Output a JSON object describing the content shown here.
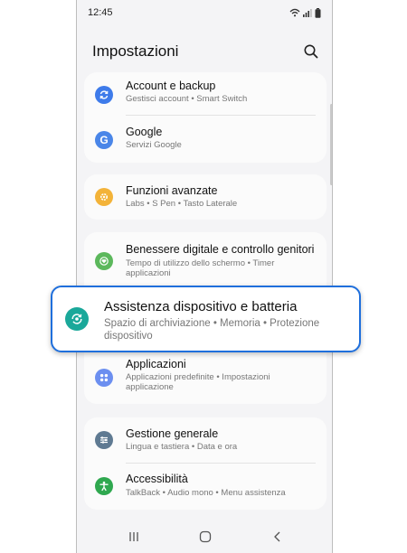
{
  "status_bar": {
    "time": "12:45"
  },
  "header": {
    "title": "Impostazioni"
  },
  "colors": {
    "accent_blue": "#1f6fdc",
    "account_icon": "#3e7bea",
    "google_icon": "#4a86e8",
    "advanced_icon": "#f3b339",
    "wellbeing_icon": "#5cb85c",
    "care_icon": "#1aa89a",
    "apps_icon": "#6c8ff0",
    "general_icon": "#5f7a92",
    "accessibility_icon": "#2fa84f"
  },
  "items": {
    "account": {
      "title": "Account e backup",
      "sub": "Gestisci account  •  Smart Switch",
      "icon": "sync-icon"
    },
    "google": {
      "title": "Google",
      "sub": "Servizi Google",
      "icon": "google-icon"
    },
    "advanced": {
      "title": "Funzioni avanzate",
      "sub": "Labs  •  S Pen  •  Tasto Laterale",
      "icon": "plus-gear-icon"
    },
    "wellbeing": {
      "title": "Benessere digitale e controllo genitori",
      "sub": "Tempo di utilizzo dello schermo  •  Timer applicazioni",
      "icon": "heart-circle-icon"
    },
    "care": {
      "title": "Assistenza dispositivo e batteria",
      "sub": "Spazio di archiviazione  •  Memoria  •  Protezione dispositivo",
      "icon": "device-care-icon"
    },
    "apps": {
      "title": "Applicazioni",
      "sub": "Applicazioni predefinite  •  Impostazioni applicazione",
      "icon": "apps-grid-icon"
    },
    "general": {
      "title": "Gestione generale",
      "sub": "Lingua e tastiera  •  Data e ora",
      "icon": "sliders-icon"
    },
    "accessibility": {
      "title": "Accessibilità",
      "sub": "TalkBack  •  Audio mono  •  Menu assistenza",
      "icon": "accessibility-icon"
    }
  }
}
